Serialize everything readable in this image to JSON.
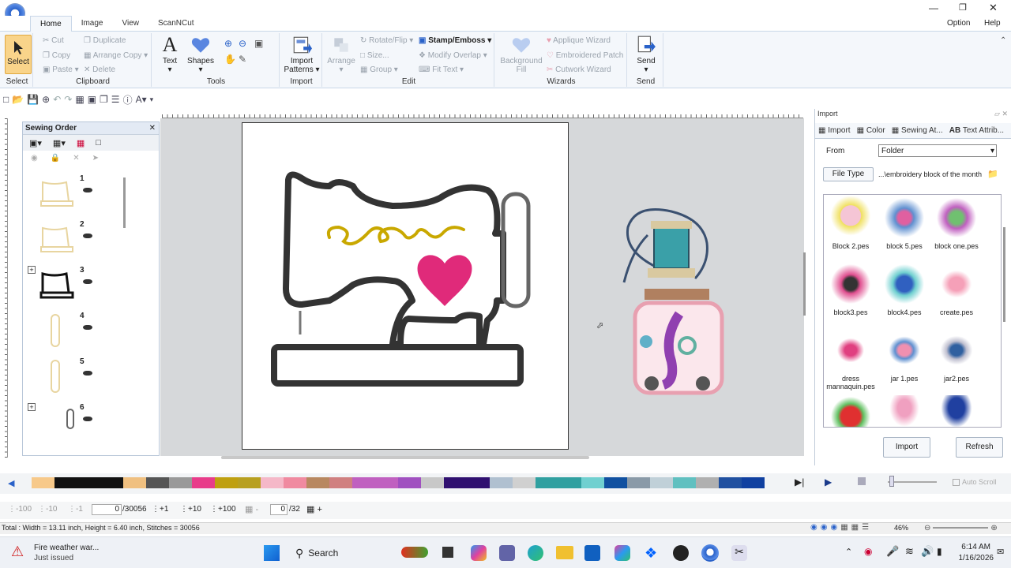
{
  "window": {
    "option": "Option",
    "help": "Help"
  },
  "tabs": [
    "Home",
    "Image",
    "View",
    "ScanNCut"
  ],
  "ribbon": {
    "select": "Select",
    "select_group": "Select",
    "clipboard": {
      "cut": "Cut",
      "copy": "Copy",
      "paste": "Paste",
      "duplicate": "Duplicate",
      "arrange_copy": "Arrange Copy",
      "delete": "Delete",
      "group": "Clipboard"
    },
    "tools": {
      "text": "Text",
      "shapes": "Shapes",
      "group": "Tools"
    },
    "import": {
      "patterns": "Import Patterns",
      "group": "Import"
    },
    "edit": {
      "arrange": "Arrange",
      "rotate_flip": "Rotate/Flip",
      "size": "Size...",
      "group_btn": "Group",
      "stamp_emboss": "Stamp/Emboss",
      "modify_overlap": "Modify Overlap",
      "fit_text": "Fit Text",
      "group": "Edit"
    },
    "wizards": {
      "background_fill": "Background Fill",
      "applique": "Applique Wizard",
      "embroidered_patch": "Embroidered Patch",
      "cutwork": "Cutwork Wizard",
      "group": "Wizards"
    },
    "send": {
      "label": "Send",
      "group": "Send"
    }
  },
  "sewing_order": {
    "title": "Sewing Order",
    "items": [
      {
        "num": "1"
      },
      {
        "num": "2"
      },
      {
        "num": "3"
      },
      {
        "num": "4"
      },
      {
        "num": "5"
      },
      {
        "num": "6"
      }
    ]
  },
  "import_panel": {
    "title": "Import",
    "tabs": [
      "Import",
      "Color",
      "Sewing At...",
      "Text Attrib..."
    ],
    "from_label": "From",
    "from_value": "Folder",
    "file_type": "File Type",
    "path": "...\\embroidery block of the month",
    "files": [
      "Block 2.pes",
      "block 5.pes",
      "block one.pes",
      "block3.pes",
      "block4.pes",
      "create.pes",
      "dress mannaquin.pes",
      "jar 1.pes",
      "jar2.pes",
      "",
      "",
      ""
    ],
    "import_btn": "Import",
    "refresh_btn": "Refresh"
  },
  "colorbar": {
    "auto_scroll": "Auto Scroll",
    "colors": [
      "#f7c98a",
      "#111111",
      "#111111",
      "#111111",
      "#f0c080",
      "#555555",
      "#999999",
      "#e83c8a",
      "#bfa010",
      "#b8a020",
      "#f5b8c8",
      "#f08aa0",
      "#b88860",
      "#d08080",
      "#c060c0",
      "#c060c0",
      "#a050c0",
      "#c8c8c8",
      "#301070",
      "#301070",
      "#b0c0d0",
      "#d0d0d0",
      "#30a0a0",
      "#30a0a0",
      "#70d0d0",
      "#1050a0",
      "#8a9aa8",
      "#c0d0d8",
      "#60c0c0",
      "#b0b0b0",
      "#2050a0",
      "#1040a0"
    ]
  },
  "status": {
    "s1": "-100",
    "s2": "-10",
    "s3": "-1",
    "stitch_value": "0",
    "stitch_total": "/30056",
    "p1": "+1",
    "p2": "+10",
    "p3": "+100",
    "page_value": "0",
    "page_total": "/32"
  },
  "info": {
    "text": "Total : Width = 13.11 inch, Height = 6.40 inch, Stitches = 30056",
    "zoom": "46%"
  },
  "taskbar": {
    "alert_title": "Fire weather war...",
    "alert_sub": "Just issued",
    "search": "Search",
    "time": "6:14 AM",
    "date": "1/16/2026"
  }
}
